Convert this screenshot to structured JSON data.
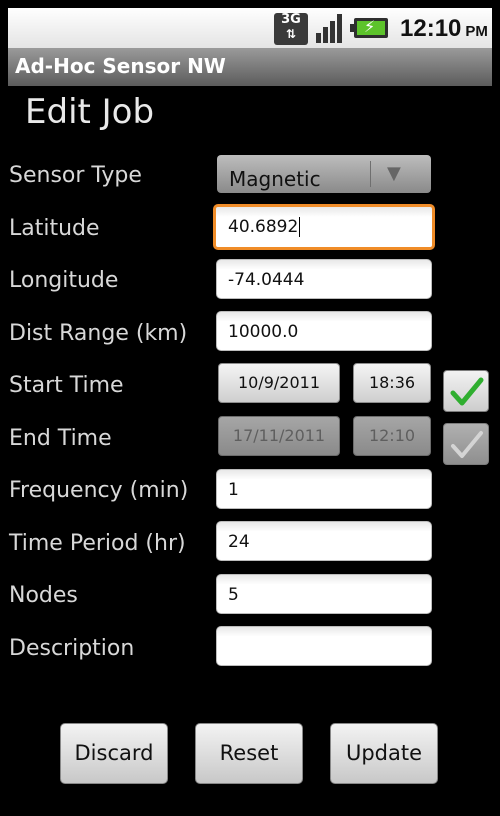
{
  "status_bar": {
    "network_label": "3G",
    "time": "12:10",
    "ampm": "PM"
  },
  "app": {
    "title": "Ad-Hoc Sensor NW"
  },
  "page": {
    "heading": "Edit Job"
  },
  "form": {
    "sensor_type": {
      "label": "Sensor Type",
      "value": "Magnetic"
    },
    "latitude": {
      "label": "Latitude",
      "value": "40.6892"
    },
    "longitude": {
      "label": "Longitude",
      "value": "-74.0444"
    },
    "dist_range": {
      "label": "Dist Range (km)",
      "value": "10000.0"
    },
    "start_time": {
      "label": "Start Time",
      "date": "10/9/2011",
      "time": "18:36",
      "checked": true
    },
    "end_time": {
      "label": "End Time",
      "date": "17/11/2011",
      "time": "12:10",
      "checked": false
    },
    "frequency": {
      "label": "Frequency (min)",
      "value": "1"
    },
    "time_period": {
      "label": "Time Period (hr)",
      "value": "24"
    },
    "nodes": {
      "label": "Nodes",
      "value": "5"
    },
    "description": {
      "label": "Description",
      "value": ""
    }
  },
  "actions": {
    "discard": "Discard",
    "reset": "Reset",
    "update": "Update"
  },
  "colors": {
    "focus_border": "#f08c28",
    "check_green": "#2fae2f"
  }
}
